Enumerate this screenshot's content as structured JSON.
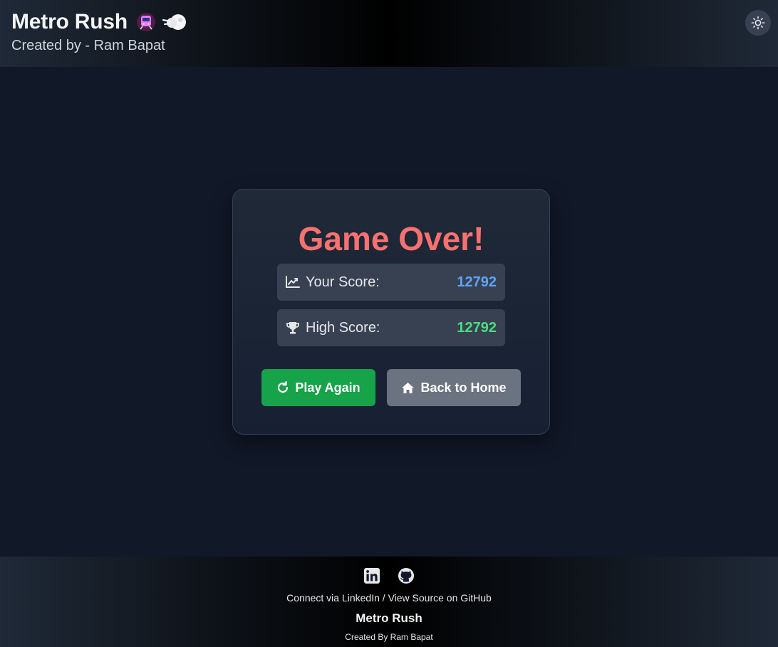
{
  "header": {
    "title": "Metro Rush",
    "emoji_train": "metro-train-icon",
    "emoji_dash": "dash-icon",
    "subtitle": "Created by - Ram Bapat",
    "theme_toggle_icon": "sun-icon"
  },
  "game_over": {
    "title": "Game Over!",
    "your_score": {
      "label": "Your Score:",
      "value": "12792",
      "icon": "chart-line-icon",
      "color": "#60a5fa"
    },
    "high_score": {
      "label": "High Score:",
      "value": "12792",
      "icon": "trophy-icon",
      "color": "#4ade80"
    },
    "play_again_label": "Play Again",
    "back_home_label": "Back to Home"
  },
  "footer": {
    "linkedin_icon": "linkedin-icon",
    "github_icon": "github-icon",
    "connect_text": "Connect via LinkedIn",
    "separator": " / ",
    "source_text": "View Source on GitHub",
    "title": "Metro Rush",
    "credit": "Created By Ram Bapat"
  },
  "colors": {
    "background": "#111827",
    "game_over": "#f87171",
    "play_button": "#16a34a",
    "home_button": "#6b7280"
  }
}
